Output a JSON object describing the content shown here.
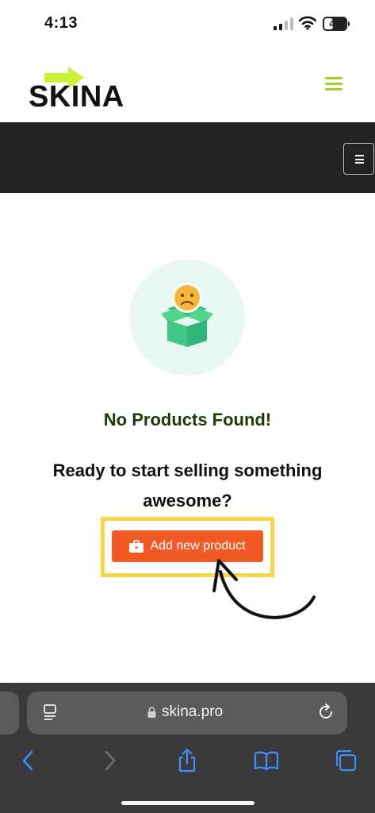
{
  "status_bar": {
    "time": "4:13",
    "battery_text": "40",
    "battery_level": 0.4
  },
  "header": {
    "logo_text": "SKINA",
    "brand_color": "#a3cf2b"
  },
  "empty_state": {
    "title": "No Products Found!",
    "subtitle": "Ready to start selling something awesome?",
    "button_label": "Add new product",
    "button_color": "#f15a24",
    "highlight_color": "#f7d648"
  },
  "browser": {
    "url": "skina.pro"
  },
  "icons": {
    "signal": "signal-icon",
    "wifi": "wifi-icon",
    "battery": "battery-icon",
    "menu": "hamburger-icon",
    "illustration": "sad-box-icon",
    "button": "briefcase-icon",
    "annotation": "curved-arrow-icon",
    "reader": "reader-icon",
    "lock": "lock-icon",
    "reload": "reload-icon",
    "back": "chevron-left-icon",
    "forward": "chevron-right-icon",
    "share": "share-icon",
    "bookmarks": "book-icon",
    "tabs": "tabs-icon"
  }
}
